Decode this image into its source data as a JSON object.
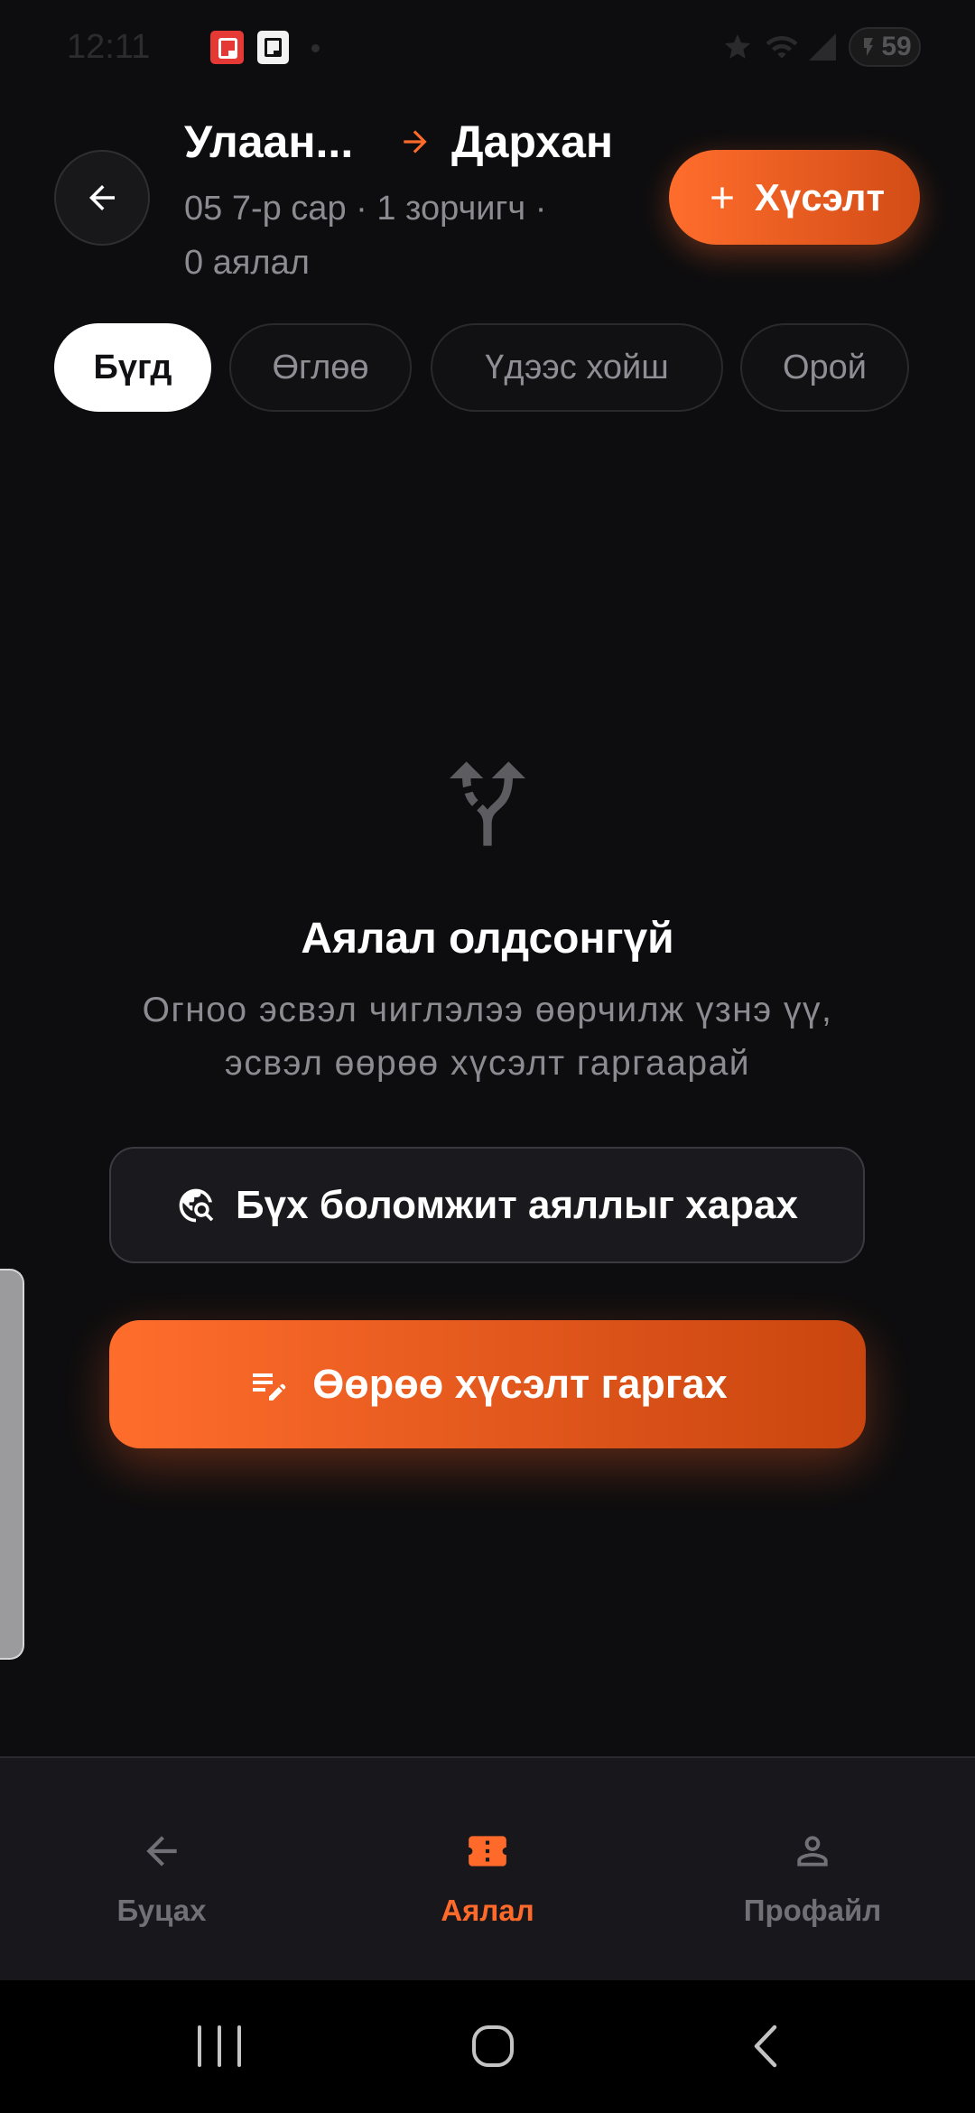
{
  "status_bar": {
    "time": "12:11",
    "battery_level": "59",
    "icons": [
      "app-notification-icon",
      "app-notification-icon",
      "dot-icon",
      "star-icon",
      "wifi-icon",
      "signal-icon",
      "battery-charging-icon"
    ]
  },
  "header": {
    "back_icon": "arrow-left-icon",
    "origin": "Улаан...",
    "route_arrow_icon": "arrow-right-icon",
    "destination": "Дархан",
    "subtitle_lines": [
      "05 7-р сар · 1 зорчигч ·",
      "0 аялал"
    ],
    "request_button": {
      "icon": "plus-icon",
      "label": "Хүсэлт"
    }
  },
  "filters": [
    {
      "label": "Бүгд",
      "active": true
    },
    {
      "label": "Өглөө",
      "active": false
    },
    {
      "label": "Үдээс хойш",
      "active": false
    },
    {
      "label": "Орой",
      "active": false
    }
  ],
  "empty_state": {
    "icon": "alt-route-icon",
    "title": "Аялал олдсонгүй",
    "description_lines": [
      "Огноо эсвэл чиглэлээ өөрчилж үзнэ үү,",
      "эсвэл өөрөө хүсэлт гаргаарай"
    ],
    "view_all_button": {
      "icon": "travel-explore-icon",
      "label": "Бүх боломжит аяллыг харах"
    },
    "create_request_button": {
      "icon": "edit-note-icon",
      "label": "Өөрөө хүсэлт гаргах"
    }
  },
  "bottom_nav": {
    "items": [
      {
        "label": "Буцах",
        "icon": "arrow-left-icon",
        "active": false
      },
      {
        "label": "Аялал",
        "icon": "ticket-icon",
        "active": true
      },
      {
        "label": "Профайл",
        "icon": "person-icon",
        "active": false
      }
    ]
  },
  "system_nav": {
    "buttons": [
      "recents-icon",
      "home-icon",
      "back-icon"
    ]
  },
  "colors": {
    "background": "#0d0d0f",
    "surface": "#18181c",
    "accent": "#ff6a2a",
    "accent_dark": "#c9450f",
    "text_primary": "#ffffff",
    "text_secondary": "#8b8b91",
    "inactive": "#707076"
  }
}
